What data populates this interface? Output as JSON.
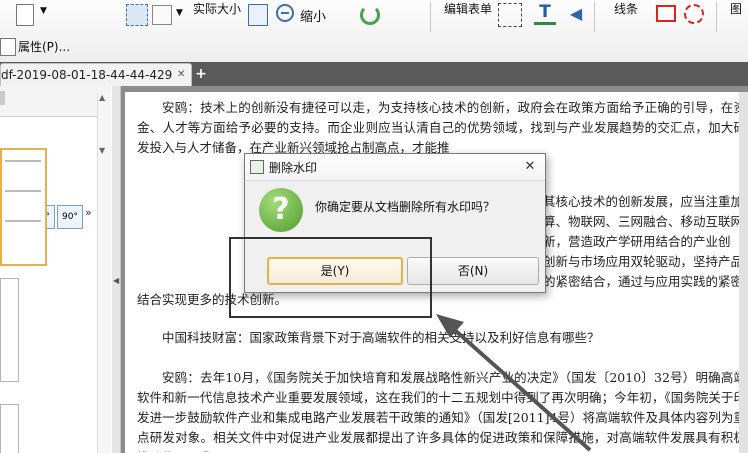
{
  "toolbar": {
    "actual_size": "实际大小",
    "zoom_out": "缩小",
    "edit_form": "编辑表单",
    "lines": "线条",
    "partial_right": "图",
    "properties": "属性(P)..."
  },
  "tab": {
    "title": "df-2019-08-01-18-44-44-429",
    "add": "+"
  },
  "panel": {
    "rot1": "90°",
    "rot2": "90°"
  },
  "document": {
    "p1": "安鸥：技术上的创新没有捷径可以走，为支持核心技术的创新，政府会在政策方面给予正确的引导，在资金、人才等方面给予必要的支持。而企业则应当认清自己的优势领域，找到与产业发展趋势的交汇点，加大研发投入与人才储备，在产业新兴领域抢占制高点，才能推",
    "p2_visible_right": "其核心技术的创新发展，应当注重加",
    "p2_line2": "算、物联网、三网融合、移动互联网",
    "p2_line3": "新，营造政产学研用结合的产业创",
    "p2_line4": "创新与市场应用双轮驱动，坚持产品",
    "p2_line5": "的紧密结合，通过与应用实践的紧密",
    "p2_last": "结合实现更多的技术创新。",
    "p3": "中国科技财富：国家政策背景下对于高端软件的相关支持以及利好信息有哪些？",
    "p4": "安鸥：去年10月，《国务院关于加快培育和发展战略性新兴产业的决定》（国发〔2010〕32号）明确高端软件和新一代信息技术产业重要发展领域，这在我们的十二五规划中得到了再次明确；今年初，《国务院关于印发进一步鼓励软件产业和集成电路产业发展若干政策的通知》（国发[2011]4号）将高端软件及具体内容列为重点研发对象。相关文件中对促进产业发展都提出了许多具体的促进政策和保障措施，对高端软件发展具有积极推动作用。我"
  },
  "dialog": {
    "title": "删除水印",
    "message": "你确定要从文档删除所有水印吗？",
    "yes": "是(Y)",
    "no": "否(N)",
    "close": "✕"
  },
  "colors": {
    "accent": "#e6b04a",
    "question": "#6db33f",
    "annotation": "#333333"
  }
}
